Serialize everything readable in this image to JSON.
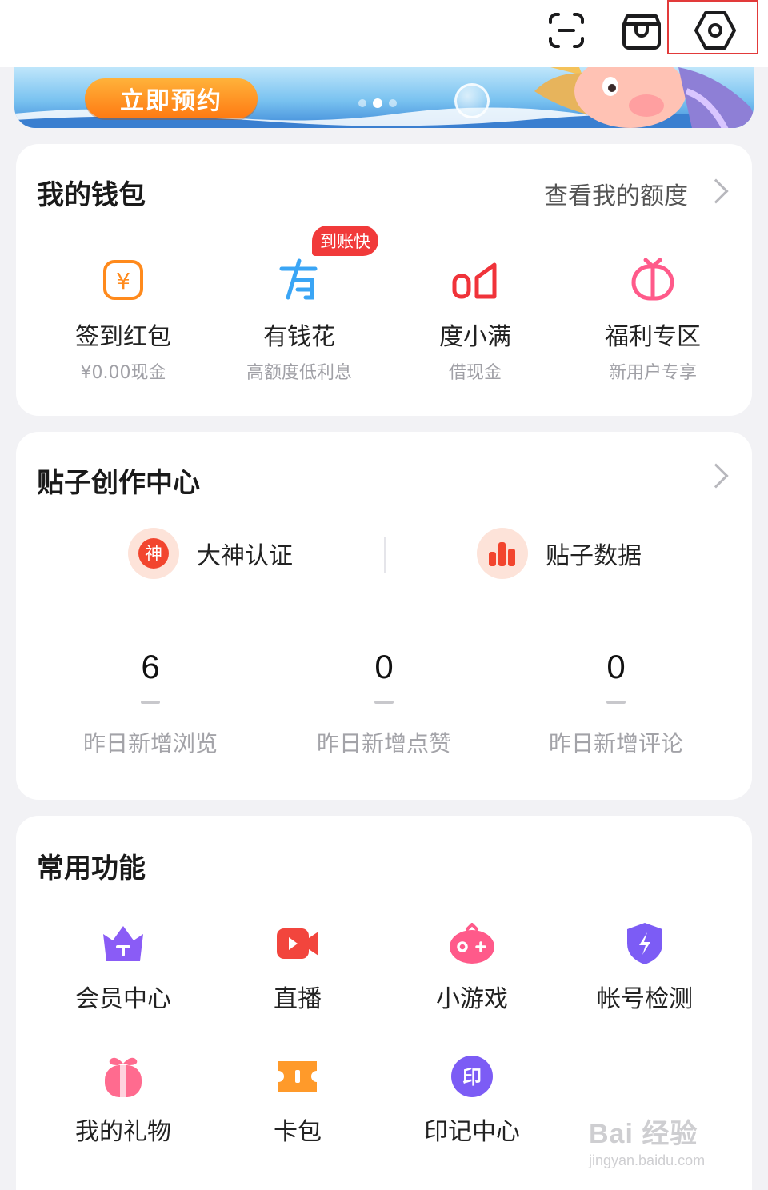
{
  "topbar": {
    "icons": [
      "scan-icon",
      "package-icon",
      "settings-icon"
    ]
  },
  "banner": {
    "button_label": "立即预约",
    "slides": 3,
    "active_slide": 2
  },
  "wallet": {
    "title": "我的钱包",
    "link_label": "查看我的额度",
    "badge": "到账快",
    "items": [
      {
        "label": "签到红包",
        "sub": "¥0.00现金",
        "icon": "red-packet-icon",
        "color": "#ff8a1c"
      },
      {
        "label": "有钱花",
        "sub": "高额度低利息",
        "icon": "youqianhua-icon",
        "color": "#3aa5f5"
      },
      {
        "label": "度小满",
        "sub": "借现金",
        "icon": "duxiaoman-icon",
        "color": "#f0333a"
      },
      {
        "label": "福利专区",
        "sub": "新用户专享",
        "icon": "welfare-icon",
        "color": "#ff5a8a"
      }
    ]
  },
  "creator": {
    "title": "贴子创作中心",
    "actions": [
      {
        "label": "大神认证",
        "icon": "god-badge-icon",
        "glyph": "神"
      },
      {
        "label": "贴子数据",
        "icon": "bar-chart-icon"
      }
    ],
    "stats": [
      {
        "value": "6",
        "label": "昨日新增浏览"
      },
      {
        "value": "0",
        "label": "昨日新增点赞"
      },
      {
        "value": "0",
        "label": "昨日新增评论"
      }
    ]
  },
  "functions": {
    "title": "常用功能",
    "items": [
      {
        "label": "会员中心",
        "icon": "crown-icon",
        "color": "#8a5cf6"
      },
      {
        "label": "直播",
        "icon": "live-camera-icon",
        "color": "#f2453d"
      },
      {
        "label": "小游戏",
        "icon": "game-controller-icon",
        "color": "#ff5a8a"
      },
      {
        "label": "帐号检测",
        "icon": "shield-icon",
        "color": "#7c5cf5"
      },
      {
        "label": "我的礼物",
        "icon": "gift-icon",
        "color": "#ff6b8f"
      },
      {
        "label": "卡包",
        "icon": "ticket-icon",
        "color": "#ff9a2a"
      },
      {
        "label": "印记中心",
        "icon": "seal-icon",
        "color": "#7c5cf5",
        "glyph": "印"
      }
    ]
  },
  "watermark": {
    "main": "Bai 经验",
    "sub": "jingyan.baidu.com"
  }
}
